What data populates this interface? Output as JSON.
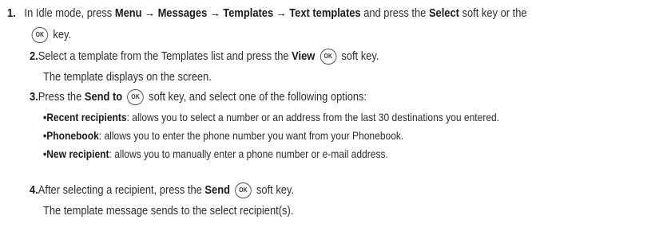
{
  "key_glyph": "OK",
  "step1": {
    "number": "1.",
    "text_a": "In Idle mode, press ",
    "bold_a": "Menu → Messages → Templates → Text templates",
    "text_b": " and press the ",
    "bold_b": "Select",
    "text_c": " soft key or the",
    "text_d": "key."
  },
  "step2": {
    "number": "2.",
    "text_a": "Select a template from the Templates list and press the ",
    "bold_a": "View",
    "text_b": "soft key.",
    "result": "The template displays on the screen."
  },
  "step3": {
    "number": "3.",
    "text_a": "Press the ",
    "bold_a": "Send to",
    "text_b": "soft key, and select one of the following options:",
    "options": [
      {
        "bullet": "•",
        "label": "Recent recipients",
        "desc": ": allows you to select a number or an address from the last 30 destinations you entered."
      },
      {
        "bullet": "•",
        "label": "Phonebook",
        "desc": ": allows you to enter the phone number you want from your Phonebook."
      },
      {
        "bullet": "•",
        "label": "New recipient",
        "desc": ": allows you to manually enter a phone number or e-mail address."
      }
    ]
  },
  "step4": {
    "number": "4.",
    "text_a": "After selecting a recipient, press the ",
    "bold_a": "Send",
    "text_b": "soft key.",
    "result": "The template message sends to the select recipient(s)."
  }
}
